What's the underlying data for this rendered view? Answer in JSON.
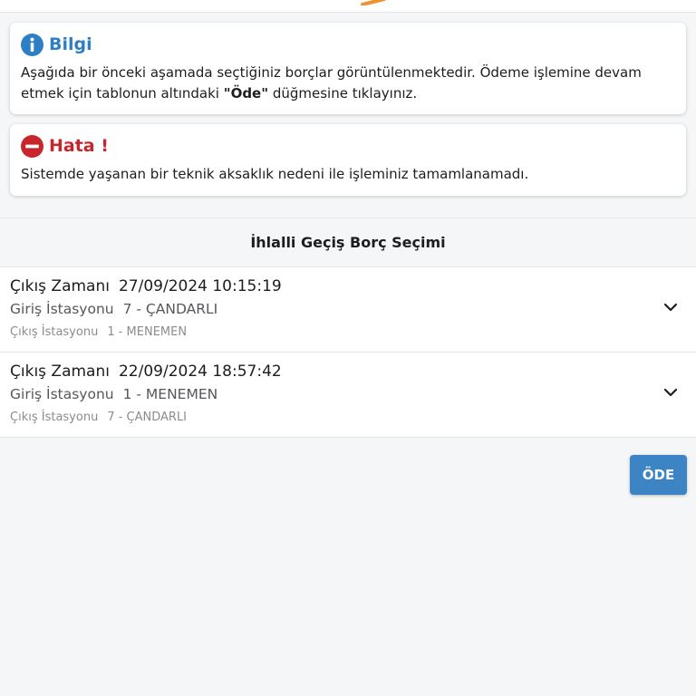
{
  "info_card": {
    "icon": "info-icon",
    "title": "Bilgi",
    "text_part1": "Aşağıda bir önceki aşamada seçtiğiniz borçlar görüntülenmektedir. Ödeme işlemine devam etmek için tablonun altındaki ",
    "text_bold": "\"Öde\"",
    "text_part2": " düğmesine tıklayınız.",
    "color": "#2c7fc4"
  },
  "error_card": {
    "icon": "minus-circle-icon",
    "title": "Hata !",
    "text": "Sistemde yaşanan bir teknik aksaklık nedeni ile işleminiz tamamlanamadı.",
    "color": "#c9252c"
  },
  "section": {
    "title": "İhlalli Geçiş Borç Seçimi"
  },
  "labels": {
    "exit_time": "Çıkış Zamanı",
    "entry_station": "Giriş İstasyonu",
    "exit_station": "Çıkış İstasyonu"
  },
  "rows": [
    {
      "exit_time": "27/09/2024 10:15:19",
      "entry_station": "7 - ÇANDARLI",
      "exit_station": "1 - MENEMEN"
    },
    {
      "exit_time": "22/09/2024 18:57:42",
      "entry_station": "1 - MENEMEN",
      "exit_station": "7 - ÇANDARLI"
    }
  ],
  "pay_button": {
    "label": "ÖDE",
    "color": "#3c84c4"
  }
}
